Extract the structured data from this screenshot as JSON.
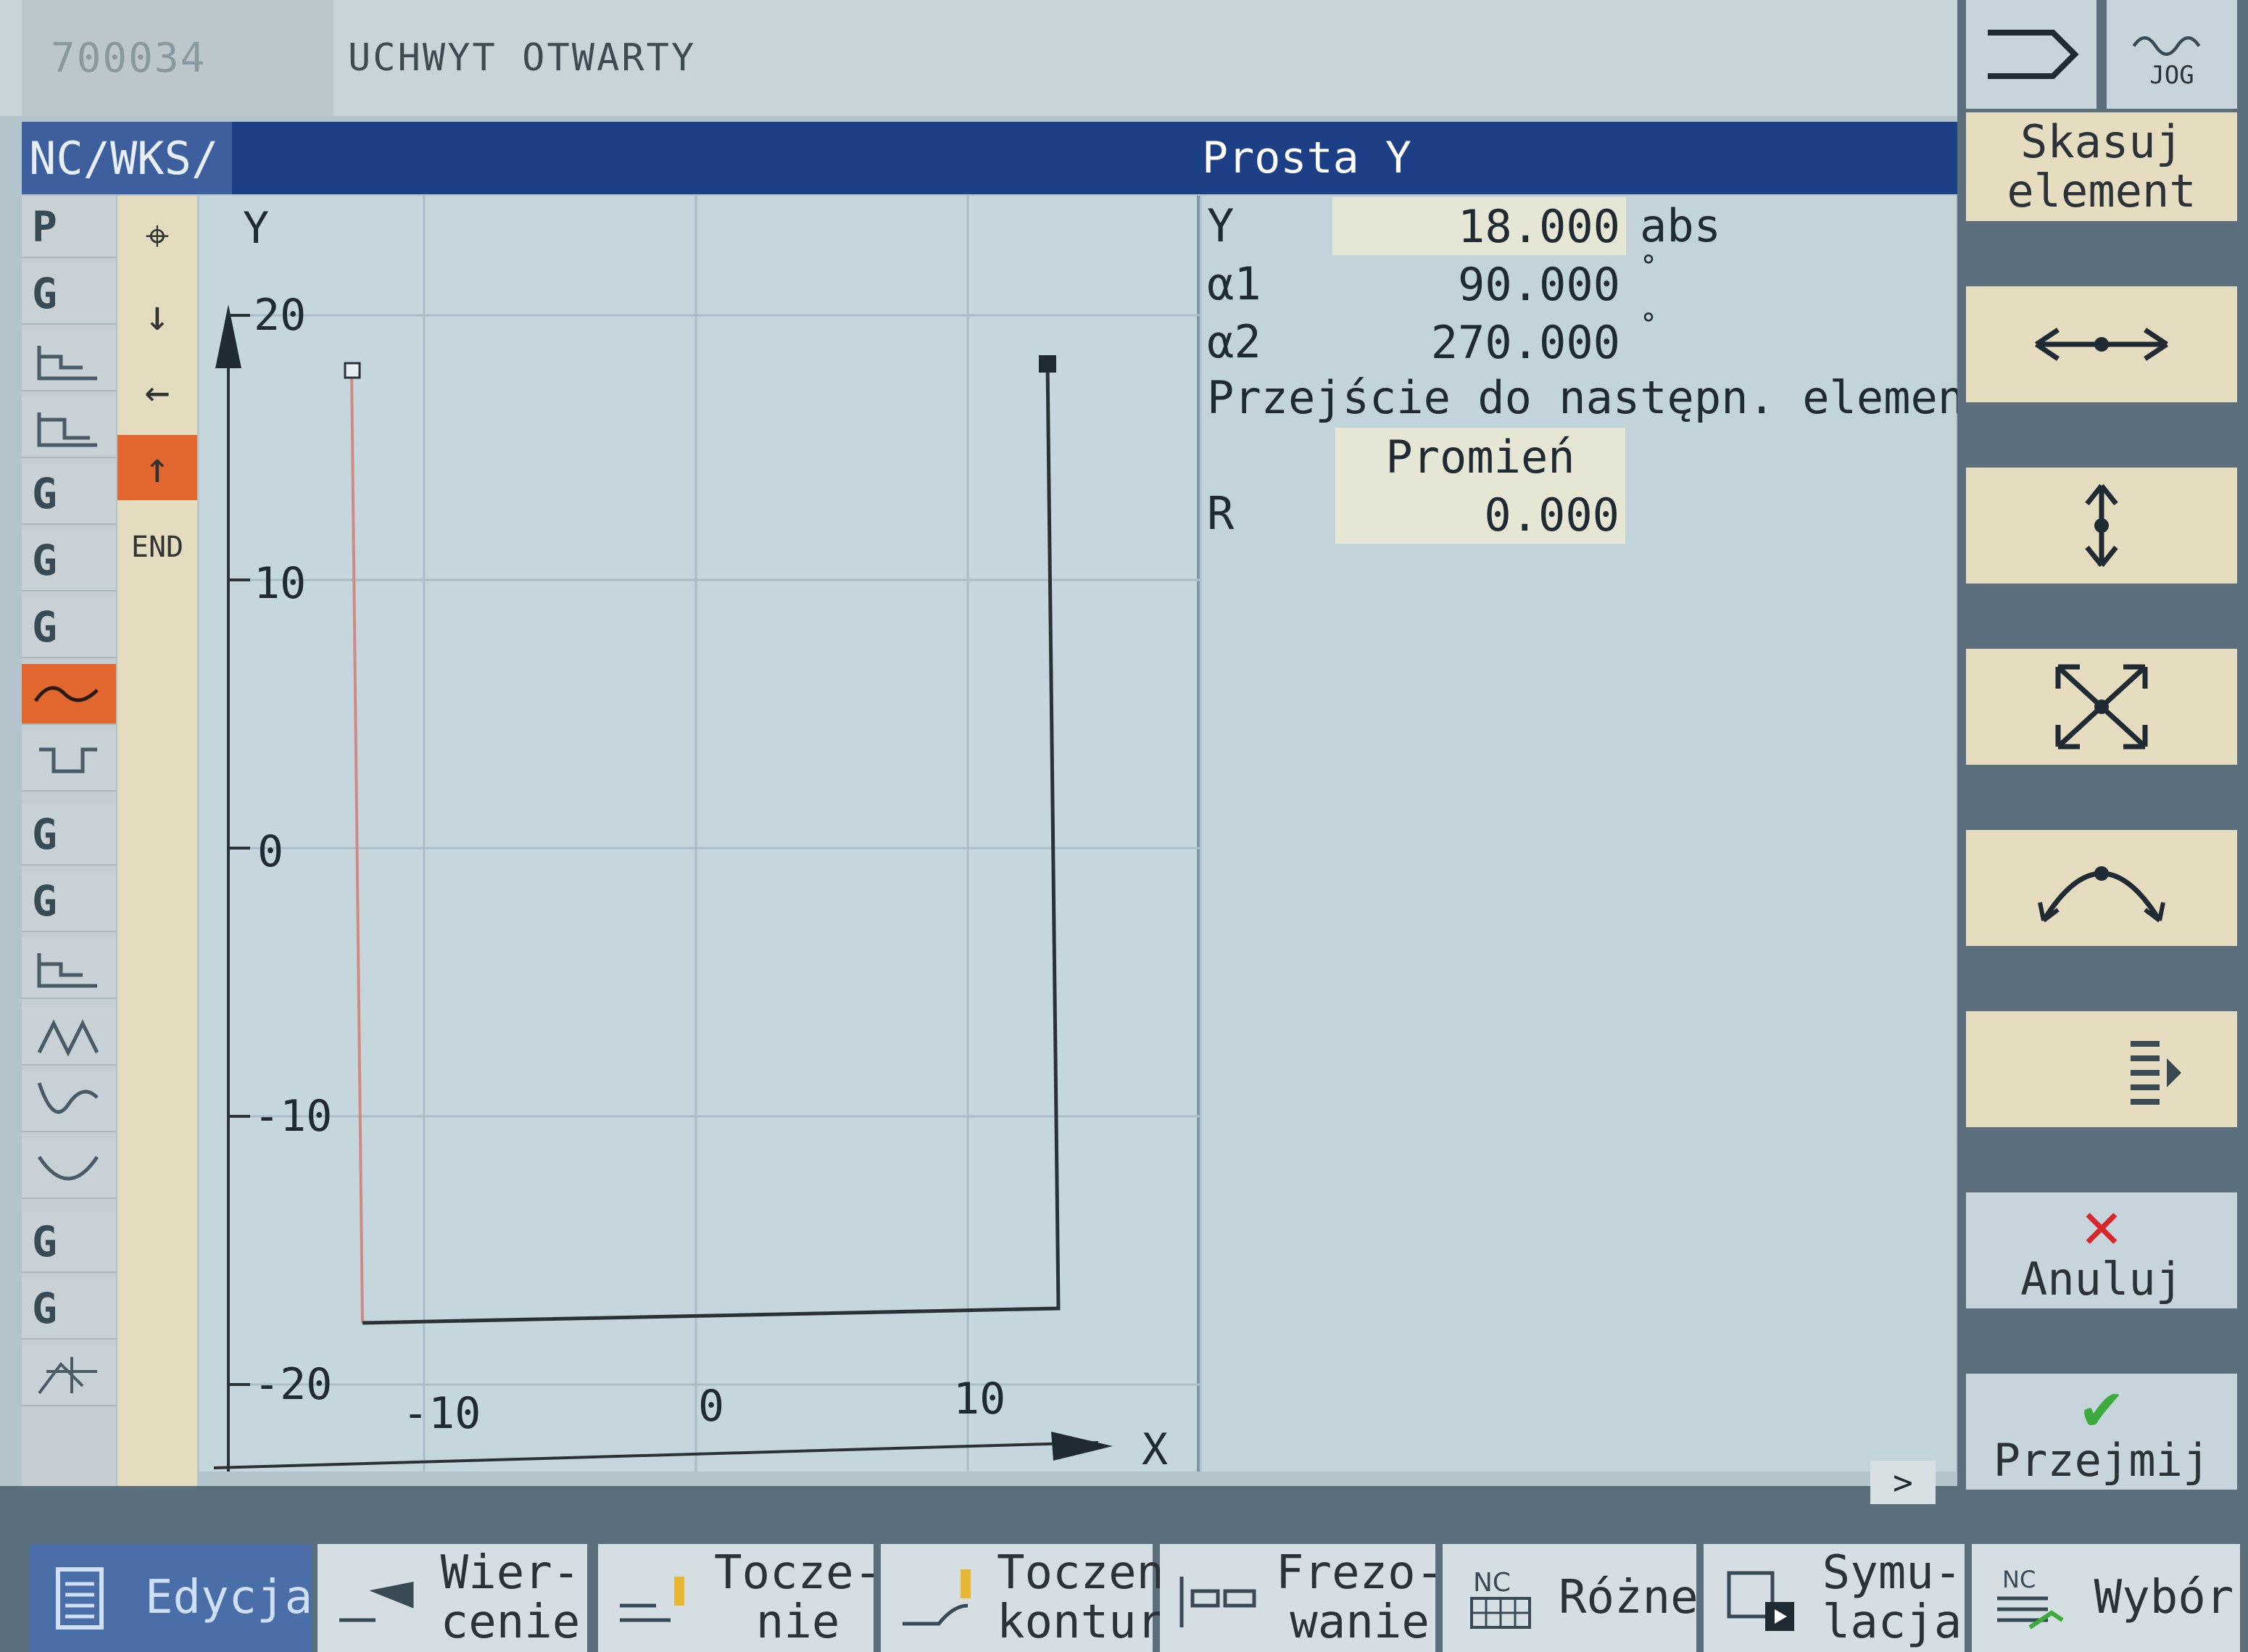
{
  "alarm": {
    "code": "700034",
    "text": "UCHWYT OTWARTY"
  },
  "header": {
    "path": "NC/WKS/",
    "title": "Prosta Y"
  },
  "tools": {
    "items": [
      "P",
      "G",
      "G",
      "G",
      "G",
      "G",
      "G",
      "G",
      "G"
    ]
  },
  "nav": {
    "end_label": "END"
  },
  "graph": {
    "y_axis_label": "Y",
    "x_axis_label": "X",
    "y_ticks": [
      "20",
      "10",
      "0",
      "-10",
      "-20"
    ],
    "x_ticks": [
      "-10",
      "0",
      "10"
    ]
  },
  "params": {
    "y_label": "Y",
    "y_value": "18.000",
    "y_unit": "abs",
    "a1_label": "α1",
    "a1_value": "90.000",
    "a1_unit": "°",
    "a2_label": "α2",
    "a2_value": "270.000",
    "a2_unit": "°",
    "transition_label": "Przejście do następn. elementu",
    "transition_value": "Promień",
    "r_label": "R",
    "r_value": "0.000"
  },
  "right_softkeys": {
    "mode": "JOG",
    "delete": [
      "Skasuj",
      "element"
    ],
    "cancel": "Anuluj",
    "accept": "Przejmij"
  },
  "bottom_softkeys": {
    "edit": "Edycja",
    "drill": [
      "Wier-",
      "cenie"
    ],
    "turn": [
      "Tocze-",
      "nie"
    ],
    "contour": [
      "Toczen.",
      "konturu"
    ],
    "mill": [
      "Frezo-",
      "wanie"
    ],
    "misc": "Różne",
    "sim": [
      "Symu-",
      "lacja"
    ],
    "select": "Wybór",
    "nc_badge": "NC"
  },
  "colors": {
    "header": "#1d3f85",
    "selected": "#e2672e",
    "cancel": "#d9262a",
    "accept": "#3caa3c"
  }
}
